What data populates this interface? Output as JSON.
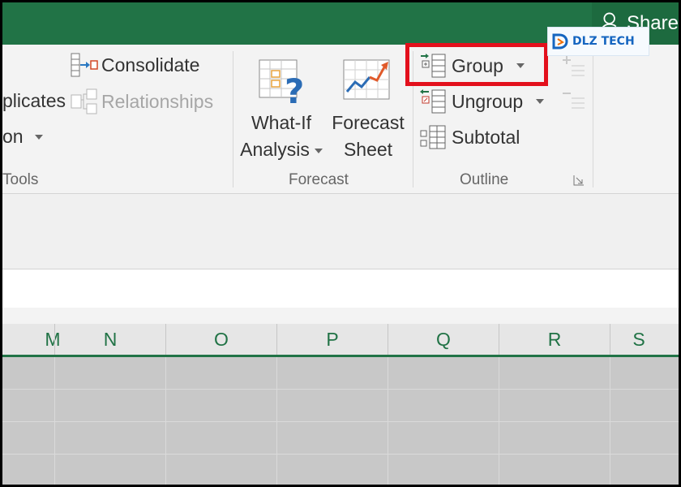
{
  "titlebar": {
    "share_label": "Share",
    "share_icon": "user-add-icon"
  },
  "ribbon": {
    "data_tools": {
      "consolidate_label": "Consolidate",
      "duplicates_label": "plicates",
      "relationships_label": "Relationships",
      "validation_label": "on",
      "group_label": "Tools"
    },
    "forecast": {
      "whatif_line1": "What-If",
      "whatif_line2": "Analysis",
      "forecast_line1": "Forecast",
      "forecast_line2": "Sheet",
      "group_label": "Forecast"
    },
    "outline": {
      "group_label_cmd": "Group",
      "ungroup_label": "Ungroup",
      "subtotal_label": "Subtotal",
      "group_label": "Outline"
    }
  },
  "watermark": {
    "text": "DLZ TECH"
  },
  "columns": [
    "M",
    "N",
    "O",
    "P",
    "Q",
    "R",
    "S"
  ],
  "colors": {
    "excel_green": "#217346",
    "highlight_red": "#e3101c"
  }
}
